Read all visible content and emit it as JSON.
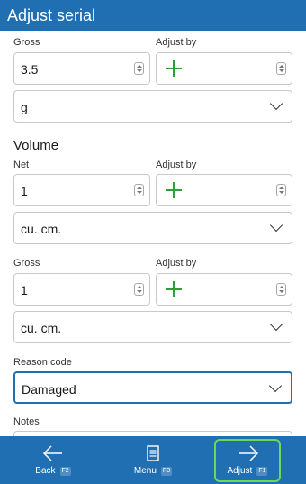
{
  "header": {
    "title": "Adjust serial"
  },
  "weight": {
    "gross_label": "Gross",
    "gross_value": "3.5",
    "adjust_label": "Adjust by",
    "unit": "g"
  },
  "volume": {
    "section_title": "Volume",
    "net_label": "Net",
    "net_value": "1",
    "net_adjust_label": "Adjust by",
    "net_unit": "cu. cm.",
    "gross_label": "Gross",
    "gross_value": "1",
    "gross_adjust_label": "Adjust by",
    "gross_unit": "cu. cm."
  },
  "reason": {
    "label": "Reason code",
    "value": "Damaged"
  },
  "notes": {
    "label": "Notes"
  },
  "footer": {
    "back": {
      "label": "Back",
      "key": "F2"
    },
    "menu": {
      "label": "Menu",
      "key": "F3"
    },
    "adjust": {
      "label": "Adjust",
      "key": "F1"
    }
  },
  "colors": {
    "brand": "#1f6fb2",
    "plus": "#2e9e3c",
    "active_outline": "#6cd85a"
  },
  "icons": [
    "plus-icon",
    "spinner-icon",
    "chevron-down-icon",
    "arrow-left-icon",
    "menu-icon",
    "arrow-right-icon"
  ]
}
